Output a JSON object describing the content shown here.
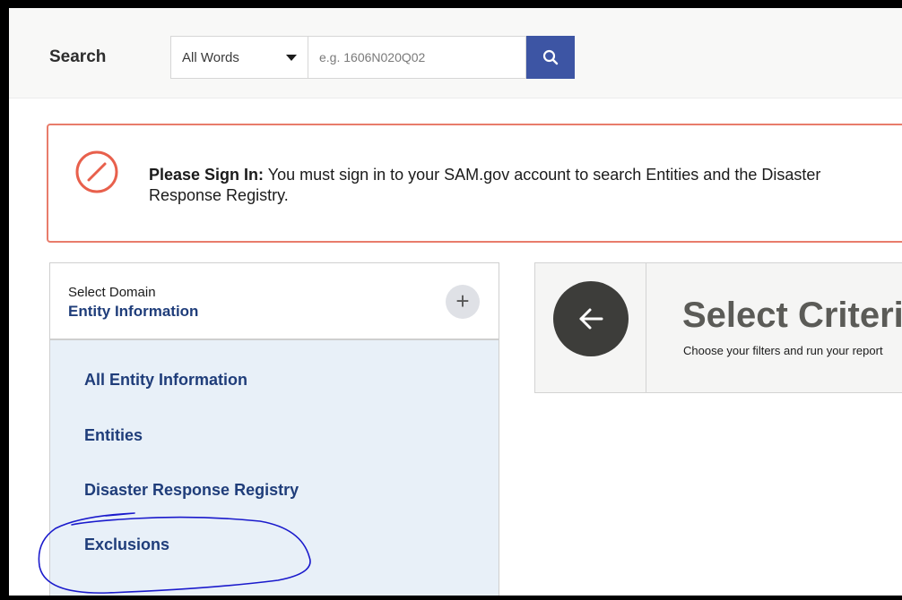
{
  "search": {
    "label": "Search",
    "select_value": "All Words",
    "placeholder": "e.g. 1606N020Q02",
    "button_icon": "search-icon"
  },
  "alert": {
    "icon": "prohibited-icon",
    "title": "Please Sign In:",
    "message": " You must sign in to your SAM.gov account to search Entities and the Disaster Response Registry."
  },
  "sidebar": {
    "domain_label": "Select Domain",
    "domain_value": "Entity Information",
    "plus_label": "+",
    "items": [
      {
        "label": "All Entity Information"
      },
      {
        "label": "Entities"
      },
      {
        "label": "Disaster Response Registry"
      },
      {
        "label": "Exclusions"
      }
    ]
  },
  "criteria": {
    "icon": "arrow-left-icon",
    "title": "Select Criteria",
    "subtitle": "Choose your filters and run your report"
  },
  "colors": {
    "accent_blue": "#3d55a4",
    "link_blue": "#1f3d7a",
    "alert_border": "#e87c6b",
    "annotation_ink": "#1a1acc"
  }
}
